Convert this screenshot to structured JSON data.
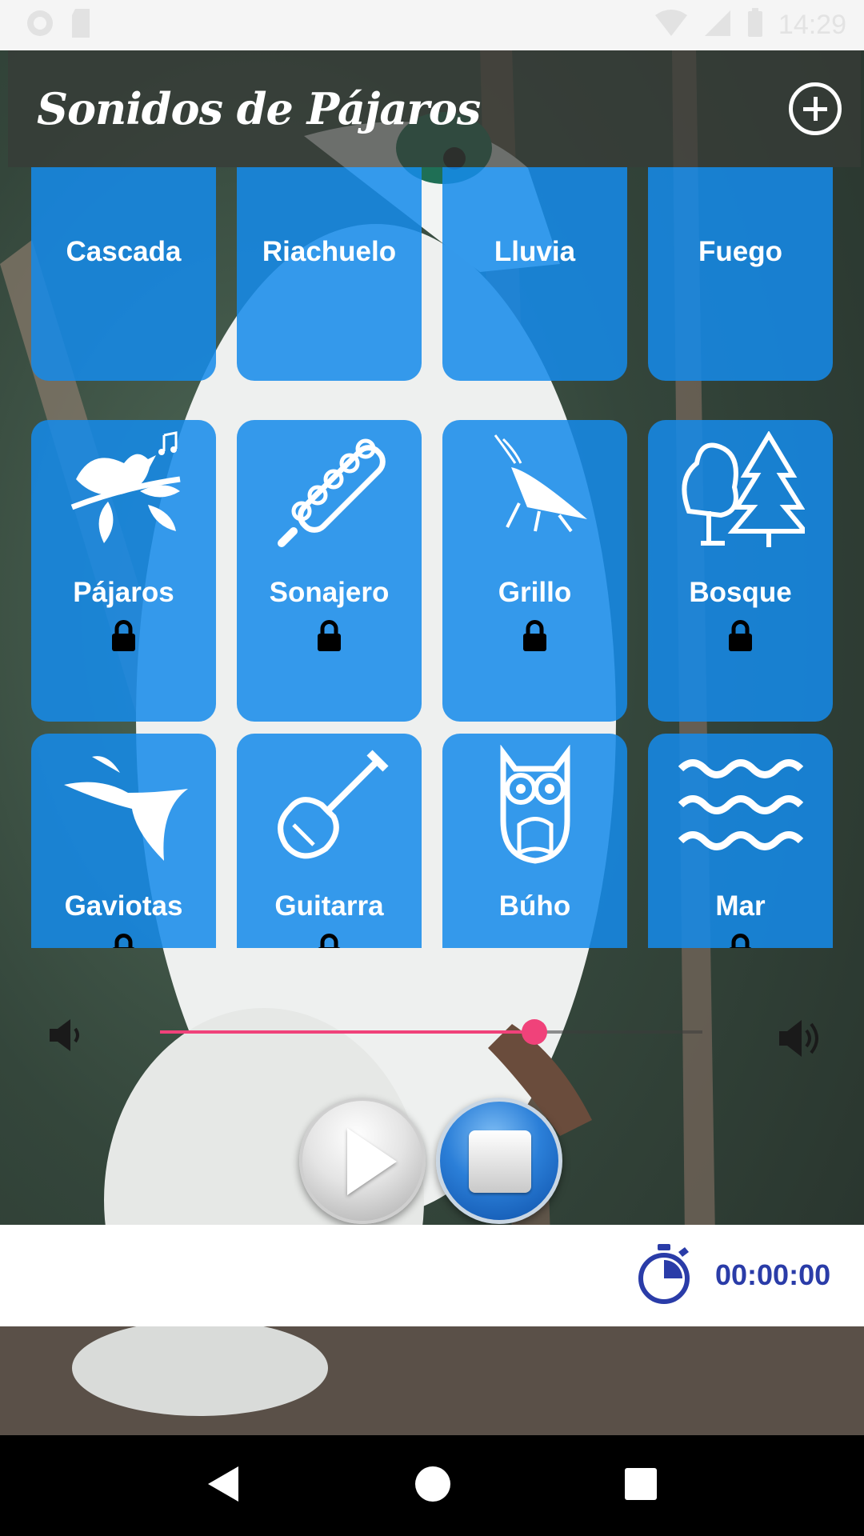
{
  "status_bar": {
    "time": "14:29"
  },
  "toolbar": {
    "title": "Sonidos de Pájaros",
    "add_icon": "add-circle-icon"
  },
  "grid": {
    "tiles": [
      {
        "label": "Cascada",
        "icon": "waterfall-icon",
        "locked": false
      },
      {
        "label": "Riachuelo",
        "icon": "stream-icon",
        "locked": false
      },
      {
        "label": "Lluvia",
        "icon": "rain-icon",
        "locked": false
      },
      {
        "label": "Fuego",
        "icon": "fire-icon",
        "locked": false
      },
      {
        "label": "Pájaros",
        "icon": "bird-icon",
        "locked": true
      },
      {
        "label": "Sonajero",
        "icon": "rattle-icon",
        "locked": true
      },
      {
        "label": "Grillo",
        "icon": "cricket-icon",
        "locked": true
      },
      {
        "label": "Bosque",
        "icon": "forest-icon",
        "locked": true
      },
      {
        "label": "Gaviotas",
        "icon": "seagull-icon",
        "locked": true
      },
      {
        "label": "Guitarra",
        "icon": "guitar-icon",
        "locked": true
      },
      {
        "label": "Búho",
        "icon": "owl-icon",
        "locked": false
      },
      {
        "label": "Mar",
        "icon": "waves-icon",
        "locked": true
      },
      {
        "label": "",
        "icon": "wind-chime-icon",
        "locked": false
      },
      {
        "label": "",
        "icon": "wind-icon",
        "locked": false
      },
      {
        "label": "",
        "icon": "cloud-icon",
        "locked": false
      },
      {
        "label": "",
        "icon": "trees-icon",
        "locked": false
      }
    ]
  },
  "volume": {
    "level": 0.69,
    "low_icon": "volume-low-icon",
    "high_icon": "volume-high-icon"
  },
  "playback": {
    "play_icon": "play-icon",
    "stop_icon": "stop-icon"
  },
  "timer": {
    "value": "00:00:00",
    "icon": "stopwatch-icon"
  },
  "colors": {
    "tile": "#158AEA",
    "accent": "#F0427A",
    "timer_text": "#2A3CA8"
  }
}
